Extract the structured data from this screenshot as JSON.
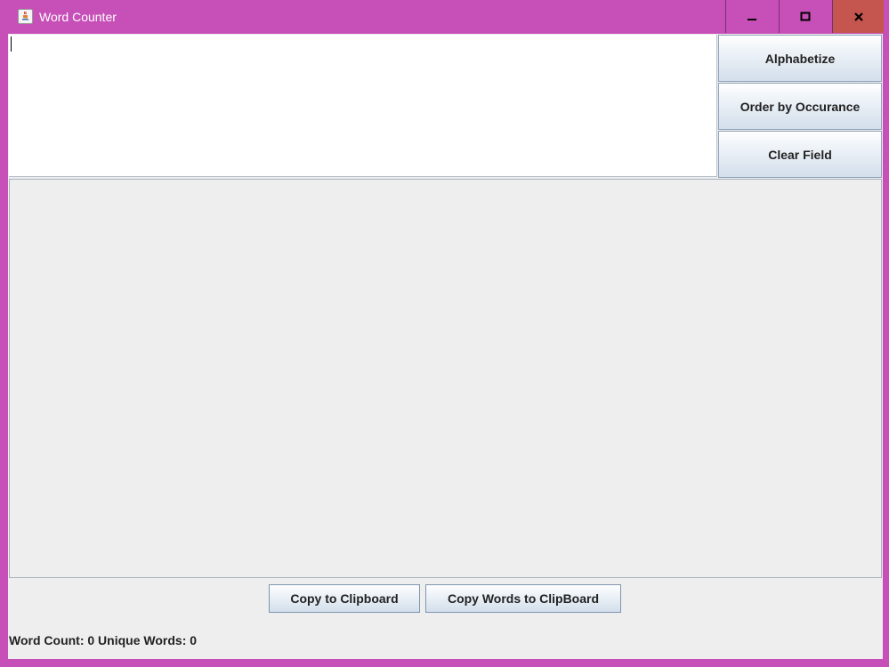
{
  "window": {
    "title": "Word Counter"
  },
  "input": {
    "value": ""
  },
  "side_buttons": {
    "alphabetize": "Alphabetize",
    "order_by_occurance": "Order by Occurance",
    "clear_field": "Clear Field"
  },
  "bottom_buttons": {
    "copy_to_clipboard": "Copy to Clipboard",
    "copy_words_to_clipboard": "Copy Words to ClipBoard"
  },
  "status": {
    "text": "Word Count: 0 Unique Words: 0"
  },
  "colors": {
    "titlebar": "#c74fb8",
    "close_button": "#c4564f",
    "panel": "#eeeeee"
  }
}
